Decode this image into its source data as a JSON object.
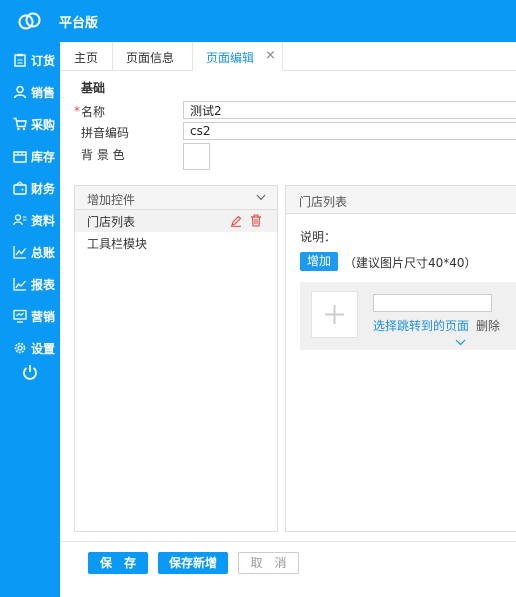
{
  "header": {
    "brand": "平台版",
    "logo_icon": "cloud-logo-icon"
  },
  "sidebar": {
    "items": [
      {
        "label": "订货",
        "icon": "clipboard-icon"
      },
      {
        "label": "销售",
        "icon": "person-icon"
      },
      {
        "label": "采购",
        "icon": "cart-icon"
      },
      {
        "label": "库存",
        "icon": "warehouse-icon"
      },
      {
        "label": "财务",
        "icon": "wallet-icon"
      },
      {
        "label": "资料",
        "icon": "contacts-icon"
      },
      {
        "label": "总账",
        "icon": "line-chart-icon"
      },
      {
        "label": "报表",
        "icon": "report-chart-icon"
      },
      {
        "label": "营销",
        "icon": "monitor-icon"
      },
      {
        "label": "设置",
        "icon": "gear-icon"
      }
    ],
    "power_icon": "power-icon"
  },
  "tabs": [
    {
      "label": "主页"
    },
    {
      "label": "页面信息"
    },
    {
      "label": "页面编辑",
      "active": true,
      "close": "×"
    }
  ],
  "form": {
    "section_title": "基础",
    "required_mark": "*",
    "name_label": "名称",
    "name_value": "测试2",
    "pinyin_label": "拼音编码",
    "pinyin_value": "cs2",
    "bg_label": "背 景 色"
  },
  "left_panel": {
    "title": "增加控件",
    "items": [
      {
        "label": "门店列表",
        "selected": true
      },
      {
        "label": "工具栏模块",
        "selected": false
      }
    ]
  },
  "right_panel": {
    "title": "门店列表",
    "desc_label": "说明：",
    "add_button": "增加",
    "hint": "（建议图片尺寸40*40）",
    "choose_link": "选择跳转到的页面",
    "remove_link": "删除"
  },
  "footer": {
    "save": "保　存",
    "save_new": "保存新增",
    "cancel": "取　消"
  },
  "colors": {
    "accent": "#0a9af5",
    "link": "#1c8fe8",
    "danger": "#e84040"
  }
}
